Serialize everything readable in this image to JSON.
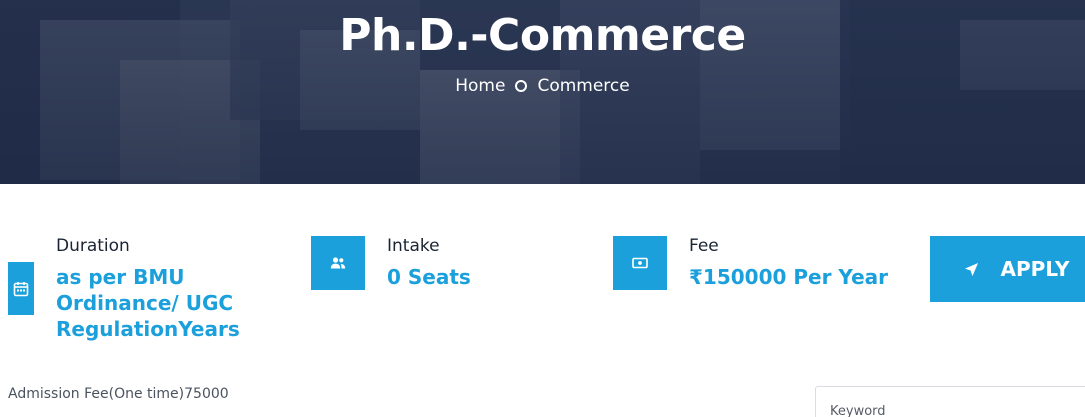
{
  "hero": {
    "title": "Ph.D.-Commerce",
    "breadcrumb": {
      "home": "Home",
      "current": "Commerce"
    }
  },
  "details": {
    "duration": {
      "label": "Duration",
      "value_lines": [
        "as per BMU",
        "Ordinance/ UGC",
        "RegulationYears"
      ],
      "icon": "calendar-icon"
    },
    "intake": {
      "label": "Intake",
      "value": "0 Seats",
      "icon": "users-icon"
    },
    "fee": {
      "label": "Fee",
      "value": "₹150000 Per Year",
      "icon": "money-icon"
    }
  },
  "apply_button": {
    "label": "APPLY",
    "icon": "send-arrow-icon"
  },
  "admission_fee": "Admission Fee(One time)75000",
  "search": {
    "placeholder": "Keyword"
  },
  "colors": {
    "accent": "#1ba0dc",
    "hero_bg": "#1e2b45"
  }
}
